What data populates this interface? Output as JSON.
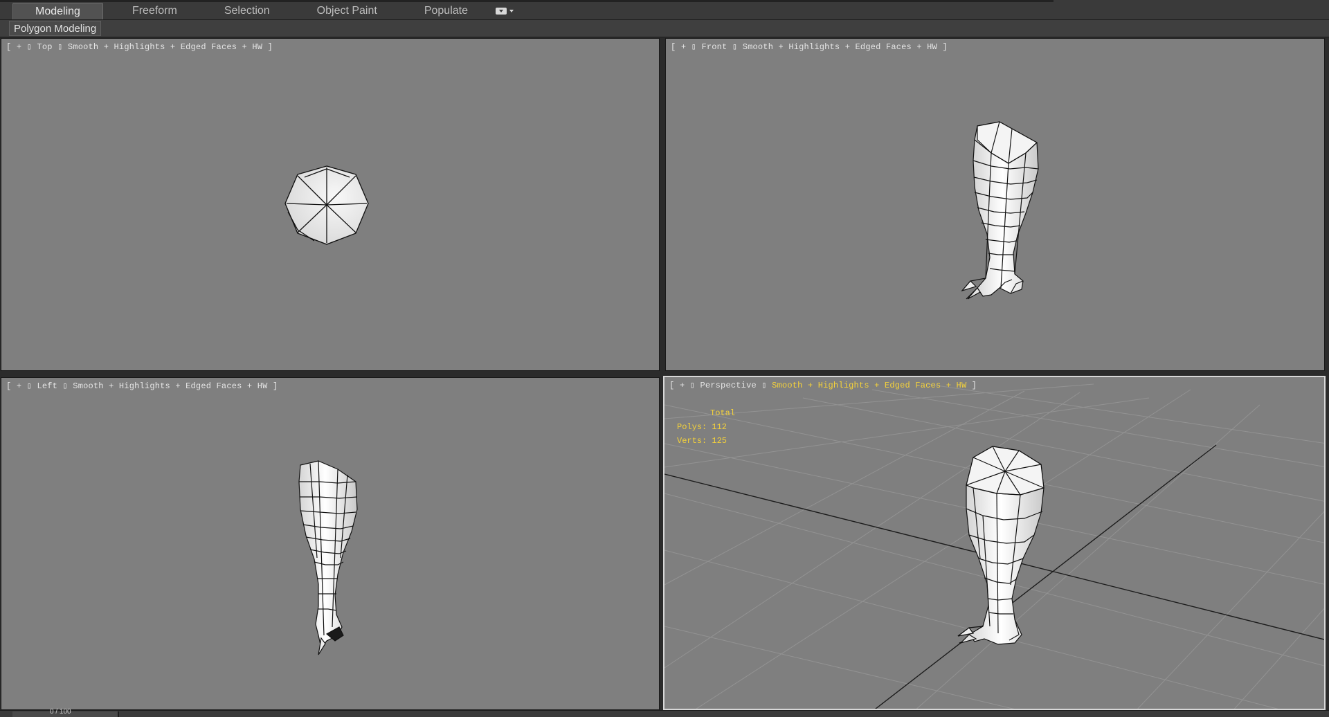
{
  "ribbon": {
    "tabs": [
      "Modeling",
      "Freeform",
      "Selection",
      "Object Paint",
      "Populate"
    ],
    "active_tab": "Modeling",
    "minimize_icon": "ribbon-dropdown-icon",
    "panel_label": "Polygon Modeling"
  },
  "viewports": {
    "top": {
      "bracket_open": "[",
      "plus": "+",
      "name": "Top",
      "shading": "Smooth + Highlights + Edged Faces + HW",
      "bracket_close": "]"
    },
    "front": {
      "bracket_open": "[",
      "plus": "+",
      "name": "Front",
      "shading": "Smooth + Highlights + Edged Faces + HW",
      "bracket_close": "]"
    },
    "left": {
      "bracket_open": "[",
      "plus": "+",
      "name": "Left",
      "shading": "Smooth + Highlights + Edged Faces + HW",
      "bracket_close": "]"
    },
    "perspective": {
      "bracket_open": "[",
      "plus": "+",
      "name": "Perspective",
      "shading": "Smooth + Highlights + Edged Faces + HW",
      "bracket_close": "]",
      "stats": {
        "header": "Total",
        "polys": "Polys: 112",
        "verts": "Verts: 125"
      }
    }
  },
  "colors": {
    "viewport_bg": "#7f7f7f",
    "highlight_text": "#f5d23a",
    "ui_dark": "#3a3a3a"
  },
  "status": {
    "frame_text": "0 / 100"
  }
}
